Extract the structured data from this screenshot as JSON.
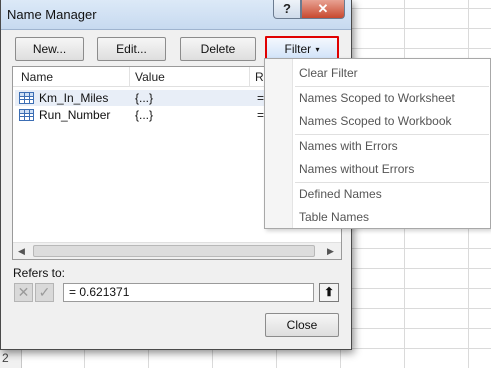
{
  "window": {
    "title": "Name Manager",
    "help_glyph": "?",
    "close_glyph": "✕"
  },
  "toolbar": {
    "new_label": "New...",
    "edit_label": "Edit...",
    "delete_label": "Delete",
    "filter_label": "Filter",
    "filter_arrow": "▾"
  },
  "list": {
    "columns": [
      "Name",
      "Value",
      "Re"
    ],
    "rows": [
      {
        "name": "Km_In_Miles",
        "value": "{...}",
        "ref": "="
      },
      {
        "name": "Run_Number",
        "value": "{...}",
        "ref": "="
      }
    ]
  },
  "refers": {
    "label": "Refers to:",
    "value": "= 0.621371",
    "collapse_glyph": "⬆",
    "cancel_glyph": "✕",
    "confirm_glyph": "✓"
  },
  "footer": {
    "close_label": "Close"
  },
  "sheet": {
    "row_number": "2"
  },
  "filter_menu": {
    "items": [
      "Clear Filter",
      "Names Scoped to Worksheet",
      "Names Scoped to Workbook",
      "Names with Errors",
      "Names without Errors",
      "Defined Names",
      "Table Names"
    ]
  },
  "colors": {
    "filter_highlight": "#e00000",
    "title_bar": "#c7daf0",
    "close_button": "#c8492f"
  }
}
